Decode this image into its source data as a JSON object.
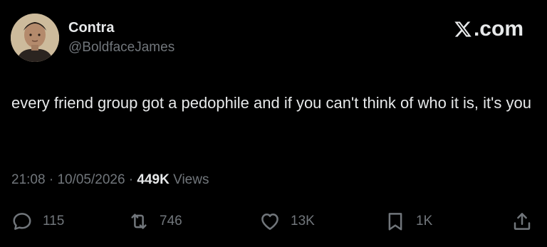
{
  "author": {
    "display_name": "Contra",
    "handle": "@BoldfaceJames"
  },
  "brand": {
    "logo_text": ".com",
    "logo_icon": "x-logo-icon"
  },
  "tweet": {
    "text": "every friend group got a pedophile and if you can't think of who it is, it's you"
  },
  "meta": {
    "time": "21:08",
    "separator1": " · ",
    "date": "10/05/2026",
    "separator2": " · ",
    "views_count": "449K",
    "views_label": " Views"
  },
  "actions": {
    "replies": "115",
    "reposts": "746",
    "likes": "13K",
    "bookmarks": "1K"
  },
  "colors": {
    "background": "#000000",
    "primary_text": "#e7e9ea",
    "secondary_text": "#71767b"
  }
}
